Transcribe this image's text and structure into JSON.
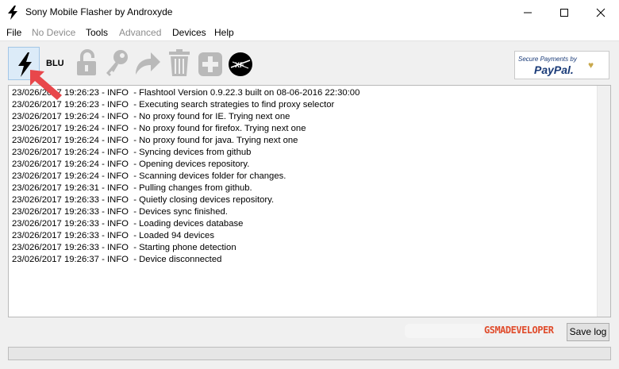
{
  "window": {
    "title": "Sony Mobile Flasher by Androxyde"
  },
  "menu": {
    "items": [
      {
        "label": "File",
        "disabled": false
      },
      {
        "label": "No Device",
        "disabled": true
      },
      {
        "label": "Tools",
        "disabled": false
      },
      {
        "label": "Advanced",
        "disabled": true
      },
      {
        "label": "Devices",
        "disabled": false
      },
      {
        "label": "Help",
        "disabled": false
      }
    ]
  },
  "toolbar": {
    "blu_label": "BLU",
    "paypal_top": "Secure Payments by",
    "paypal_main": "PayPal."
  },
  "log": {
    "lines": [
      "23/026/2017 19:26:23 - INFO  - Flashtool Version 0.9.22.3 built on 08-06-2016 22:30:00",
      "23/026/2017 19:26:23 - INFO  - Executing search strategies to find proxy selector",
      "23/026/2017 19:26:24 - INFO  - No proxy found for IE. Trying next one",
      "23/026/2017 19:26:24 - INFO  - No proxy found for firefox. Trying next one",
      "23/026/2017 19:26:24 - INFO  - No proxy found for java. Trying next one",
      "23/026/2017 19:26:24 - INFO  - Syncing devices from github",
      "23/026/2017 19:26:24 - INFO  - Opening devices repository.",
      "23/026/2017 19:26:24 - INFO  - Scanning devices folder for changes.",
      "23/026/2017 19:26:31 - INFO  - Pulling changes from github.",
      "23/026/2017 19:26:33 - INFO  - Quietly closing devices repository.",
      "23/026/2017 19:26:33 - INFO  - Devices sync finished.",
      "23/026/2017 19:26:33 - INFO  - Loading devices database",
      "23/026/2017 19:26:33 - INFO  - Loaded 94 devices",
      "23/026/2017 19:26:33 - INFO  - Starting phone detection",
      "23/026/2017 19:26:37 - INFO  - Device disconnected"
    ]
  },
  "footer": {
    "save_log_label": "Save log",
    "watermark": "GSMADEVELOPER",
    "progress": 0
  },
  "colors": {
    "accent": "#dcebf8",
    "arrow": "#e8474b",
    "watermark": "#e04c2c"
  }
}
